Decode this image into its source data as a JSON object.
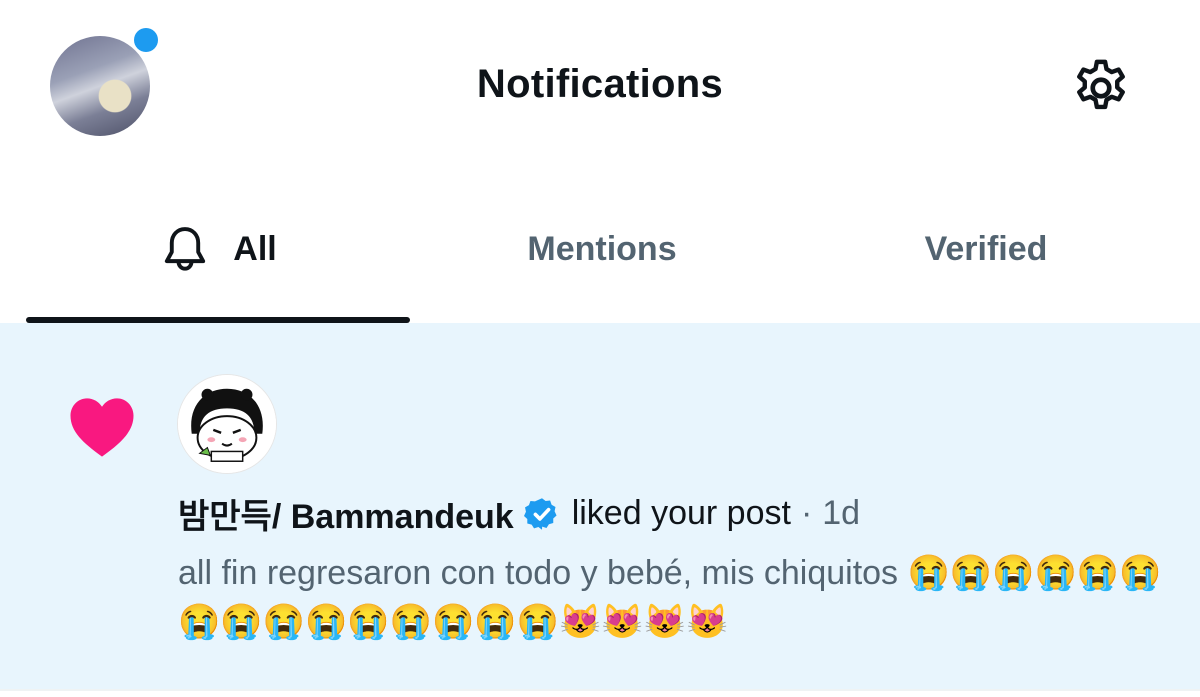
{
  "header": {
    "title": "Notifications"
  },
  "tabs": [
    {
      "label": "All"
    },
    {
      "label": "Mentions"
    },
    {
      "label": "Verified"
    }
  ],
  "colors": {
    "accent": "#1d9bf0",
    "like": "#f91880",
    "highlight_bg": "#e8f5fd",
    "text_primary": "#0f1419",
    "text_secondary": "#536471"
  },
  "icons": {
    "settings": "gear-icon",
    "tab_all": "bell-icon",
    "like": "heart-icon",
    "verified": "verified-badge-icon"
  },
  "notification": {
    "user_name": "밤만득/ Bammandeuk",
    "action": "liked your post",
    "separator": "·",
    "time": "1d",
    "post_text": "all fin regresaron con todo y bebé, mis chiquitos 😭😭😭😭😭😭😭😭😭😭😭😭😭😭😭😻😻😻😻"
  }
}
